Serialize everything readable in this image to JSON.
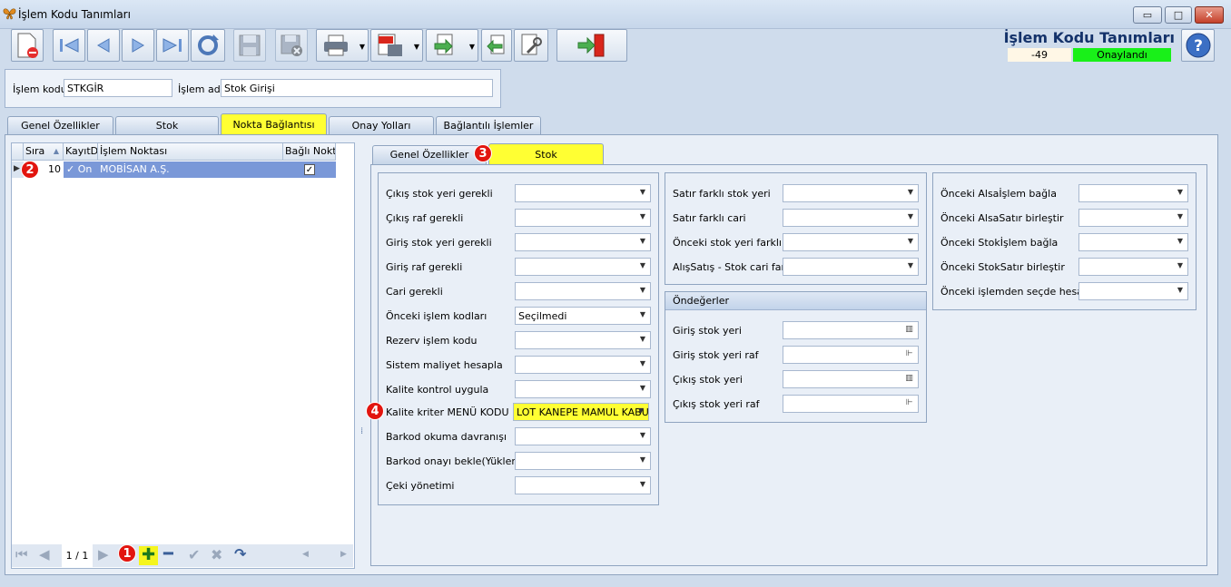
{
  "window": {
    "title": "İşlem Kodu Tanımları",
    "min": "▭",
    "max": "□",
    "close": "✕"
  },
  "header": {
    "title": "İşlem Kodu Tanımları",
    "number": "-49",
    "status": "Onaylandı",
    "help": "?"
  },
  "colors": {
    "status_green": "#19f019",
    "active_tab": "#ffff33",
    "selected_row": "#7a98d8",
    "badge": "#e2150f"
  },
  "code_form": {
    "code_label": "İşlem kodu",
    "code_value": "STKGİR",
    "name_label": "İşlem adı",
    "name_value": "Stok Girişi"
  },
  "main_tabs": [
    "Genel Özellikler",
    "Stok",
    "Nokta Bağlantısı",
    "Onay Yolları",
    "Bağlantılı İşlemler"
  ],
  "grid": {
    "columns": [
      "Sıra",
      "KayıtDı",
      "İşlem Noktası",
      "Bağlı Nokta"
    ],
    "row": {
      "sira": "10",
      "kayit": "✓ On",
      "nokta": "MOBİSAN A.Ş.",
      "bagli": "✓"
    }
  },
  "navigator": {
    "page": "1 / 1"
  },
  "sub_tabs": [
    "Genel Özellikler",
    "Stok"
  ],
  "badges": [
    "1",
    "2",
    "3",
    "4"
  ],
  "left_fields": [
    {
      "label": "Çıkış stok yeri gerekli",
      "value": ""
    },
    {
      "label": "Çıkış raf gerekli",
      "value": ""
    },
    {
      "label": "Giriş stok yeri gerekli",
      "value": ""
    },
    {
      "label": "Giriş raf gerekli",
      "value": ""
    },
    {
      "label": "Cari gerekli",
      "value": ""
    },
    {
      "label": "Önceki işlem kodları",
      "value": "Seçilmedi"
    },
    {
      "label": "Rezerv işlem kodu",
      "value": ""
    },
    {
      "label": "Sistem maliyet hesapla",
      "value": ""
    },
    {
      "label": "Kalite kontrol uygula",
      "value": ""
    },
    {
      "label": "Kalite kriter MENÜ KODU",
      "value": "LOT KANEPE MAMUL KABUL"
    },
    {
      "label": "Barkod okuma davranışı",
      "value": ""
    },
    {
      "label": "Barkod onayı bekle(Yükleme)",
      "value": ""
    },
    {
      "label": "Çeki yönetimi",
      "value": ""
    }
  ],
  "mid_fields": [
    {
      "label": "Satır farklı stok yeri",
      "value": ""
    },
    {
      "label": "Satır farklı cari",
      "value": ""
    },
    {
      "label": "Önceki stok yeri farklı",
      "value": ""
    },
    {
      "label": "AlışSatış - Stok cari farklı",
      "value": ""
    }
  ],
  "defaults": {
    "title": "Öndeğerler",
    "fields": [
      {
        "label": "Giriş stok yeri",
        "value": ""
      },
      {
        "label": "Giriş stok yeri raf",
        "value": ""
      },
      {
        "label": "Çıkış stok yeri",
        "value": ""
      },
      {
        "label": "Çıkış stok yeri raf",
        "value": ""
      }
    ]
  },
  "right_fields": [
    {
      "label": "Önceki Alsaİşlem bağla",
      "value": ""
    },
    {
      "label": "Önceki AlsaSatır birleştir",
      "value": ""
    },
    {
      "label": "Önceki Stokİşlem bağla",
      "value": ""
    },
    {
      "label": "Önceki StokSatır birleştir",
      "value": ""
    },
    {
      "label": "Önceki işlemden seçde hesapla",
      "value": ""
    }
  ]
}
